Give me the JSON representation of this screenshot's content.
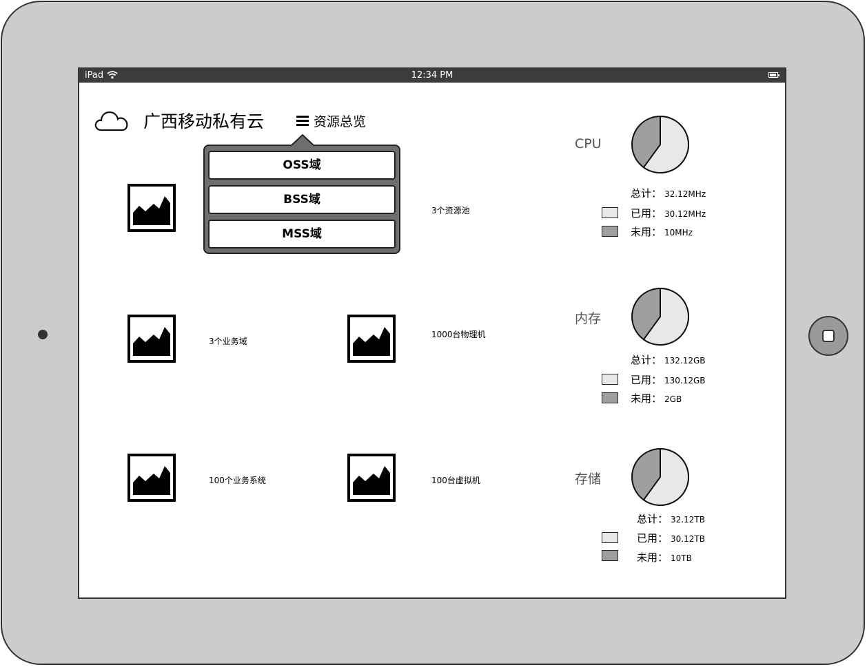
{
  "status_bar": {
    "carrier": "iPad",
    "time": "12:34 PM"
  },
  "header": {
    "brand": "广西移动私有云",
    "menu_label": "资源总览"
  },
  "dropdown": {
    "items": [
      "OSS域",
      "BSS域",
      "MSS域"
    ]
  },
  "stats": {
    "resource_pools": "3个资源池",
    "business_domains": "3个业务域",
    "physical_machines": "1000台物理机",
    "business_systems": "100个业务系统",
    "virtual_machines": "100台虚拟机"
  },
  "resources": [
    {
      "title": "CPU",
      "total_label": "总计：",
      "total": "32.12MHz",
      "used_label": "已用：",
      "used": "30.12MHz",
      "free_label": "未用：",
      "free": "10MHz",
      "used_fraction": 0.6
    },
    {
      "title": "内存",
      "total_label": "总计：",
      "total": "132.12GB",
      "used_label": "已用：",
      "used": "130.12GB",
      "free_label": "未用：",
      "free": "2GB",
      "used_fraction": 0.6
    },
    {
      "title": "存储",
      "total_label": "总计：",
      "total": "32.12TB",
      "used_label": "已用：",
      "used": "30.12TB",
      "free_label": "未用：",
      "free": "10TB",
      "used_fraction": 0.6
    }
  ],
  "colors": {
    "used": "#e8e8e8",
    "free": "#9f9f9f",
    "device": "#cccccc",
    "statusbar": "#3c3c3c"
  },
  "icons": [
    "cloud-icon",
    "menu-icon",
    "image-placeholder-icon",
    "wifi-icon",
    "battery-icon",
    "home-button-icon",
    "camera-icon"
  ]
}
